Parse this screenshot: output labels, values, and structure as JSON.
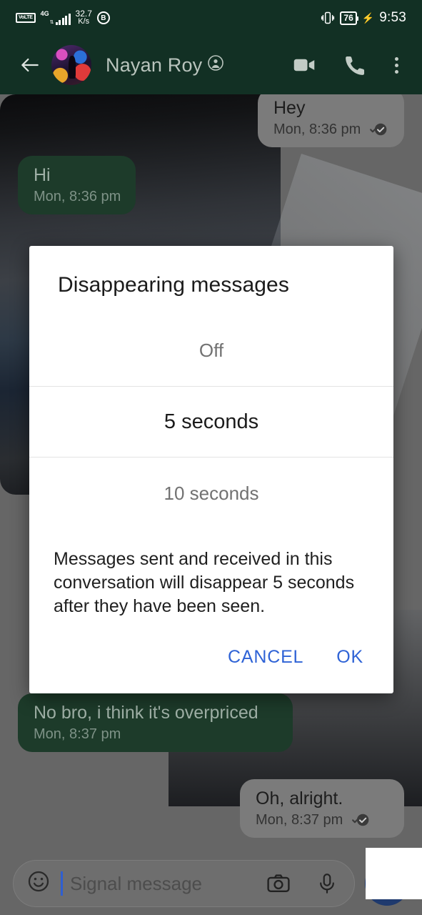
{
  "status_bar": {
    "volte_label": "VoLTE",
    "network_type": "4G",
    "data_speed_value": "32.7",
    "data_speed_unit": "K/s",
    "dnd_letter": "B",
    "vibrate_icon": "vibrate-icon",
    "battery_percent": "76",
    "charging_icon": "bolt-icon",
    "time": "9:53"
  },
  "app_bar": {
    "back_icon": "back-arrow-icon",
    "contact_name": "Nayan Roy",
    "verified_glyph": "◉",
    "video_icon": "video-call-icon",
    "call_icon": "phone-call-icon",
    "overflow_icon": "overflow-menu-icon"
  },
  "conversation": {
    "messages": [
      {
        "text": "Hey",
        "time": "Mon, 8:36 pm",
        "direction": "incoming",
        "status": "delivered"
      },
      {
        "text": "Hi",
        "time": "Mon, 8:36 pm",
        "direction": "outgoing",
        "status": ""
      },
      {
        "text": "No bro, i think it's overpriced",
        "time": "Mon, 8:37 pm",
        "direction": "outgoing",
        "status": ""
      },
      {
        "text": "Oh, alright.",
        "time": "Mon, 8:37 pm",
        "direction": "incoming",
        "status": "delivered"
      }
    ]
  },
  "composer": {
    "emoji_icon": "emoji-smiley-icon",
    "placeholder": "Signal message",
    "camera_icon": "camera-icon",
    "mic_icon": "microphone-icon",
    "send_icon": "send-button"
  },
  "dialog": {
    "title": "Disappearing messages",
    "options": [
      {
        "label": "Off",
        "selected": false
      },
      {
        "label": "5 seconds",
        "selected": true
      },
      {
        "label": "10 seconds",
        "selected": false
      }
    ],
    "body": "Messages sent and received in this conversation will disappear 5 seconds after they have been seen.",
    "cancel_label": "CANCEL",
    "ok_label": "OK"
  },
  "colors": {
    "header_green": "#123024",
    "scrim_grey": "#666666",
    "outgoing_bubble": "#1d3b2a",
    "incoming_bubble": "#7b7b7b",
    "dialog_accent": "#2f63d6",
    "send_blue": "#1f3a6e"
  }
}
